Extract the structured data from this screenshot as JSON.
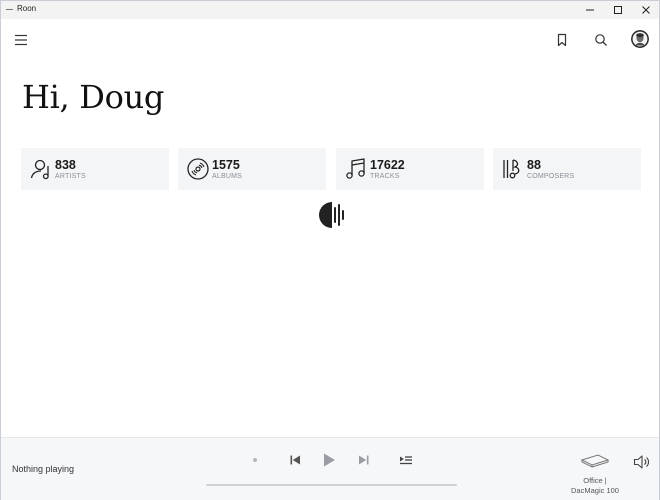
{
  "window": {
    "title": "Roon",
    "controls": {
      "minimize": "minimize-icon",
      "maximize": "maximize-icon",
      "close": "close-icon"
    }
  },
  "header": {
    "menu_icon": "hamburger-menu-icon",
    "bookmark_icon": "bookmark-icon",
    "search_icon": "search-icon",
    "avatar": "user-avatar"
  },
  "home": {
    "greeting": "Hi, Doug",
    "stats": [
      {
        "count": "838",
        "label": "ARTISTS",
        "icon": "artist-icon"
      },
      {
        "count": "1575",
        "label": "ALBUMS",
        "icon": "album-disc-icon"
      },
      {
        "count": "17622",
        "label": "TRACKS",
        "icon": "music-note-icon"
      },
      {
        "count": "88",
        "label": "COMPOSERS",
        "icon": "composer-icon"
      }
    ],
    "loading_icon": "roon-logo-icon"
  },
  "footer": {
    "now_playing": "Nothing playing",
    "controls": [
      "shuffle-dot-icon",
      "previous-icon",
      "play-icon",
      "next-icon",
      "queue-icon"
    ],
    "progress": 0,
    "zone": {
      "line1": "Office |",
      "line2": "DacMagic 100",
      "icon": "dac-device-icon"
    },
    "volume_icon": "volume-icon"
  },
  "colors": {
    "card_bg": "#f4f5f7",
    "footer_bg": "#f6f7f9",
    "label_gray": "#8a8e96",
    "text_dark": "#1b1b1b"
  }
}
